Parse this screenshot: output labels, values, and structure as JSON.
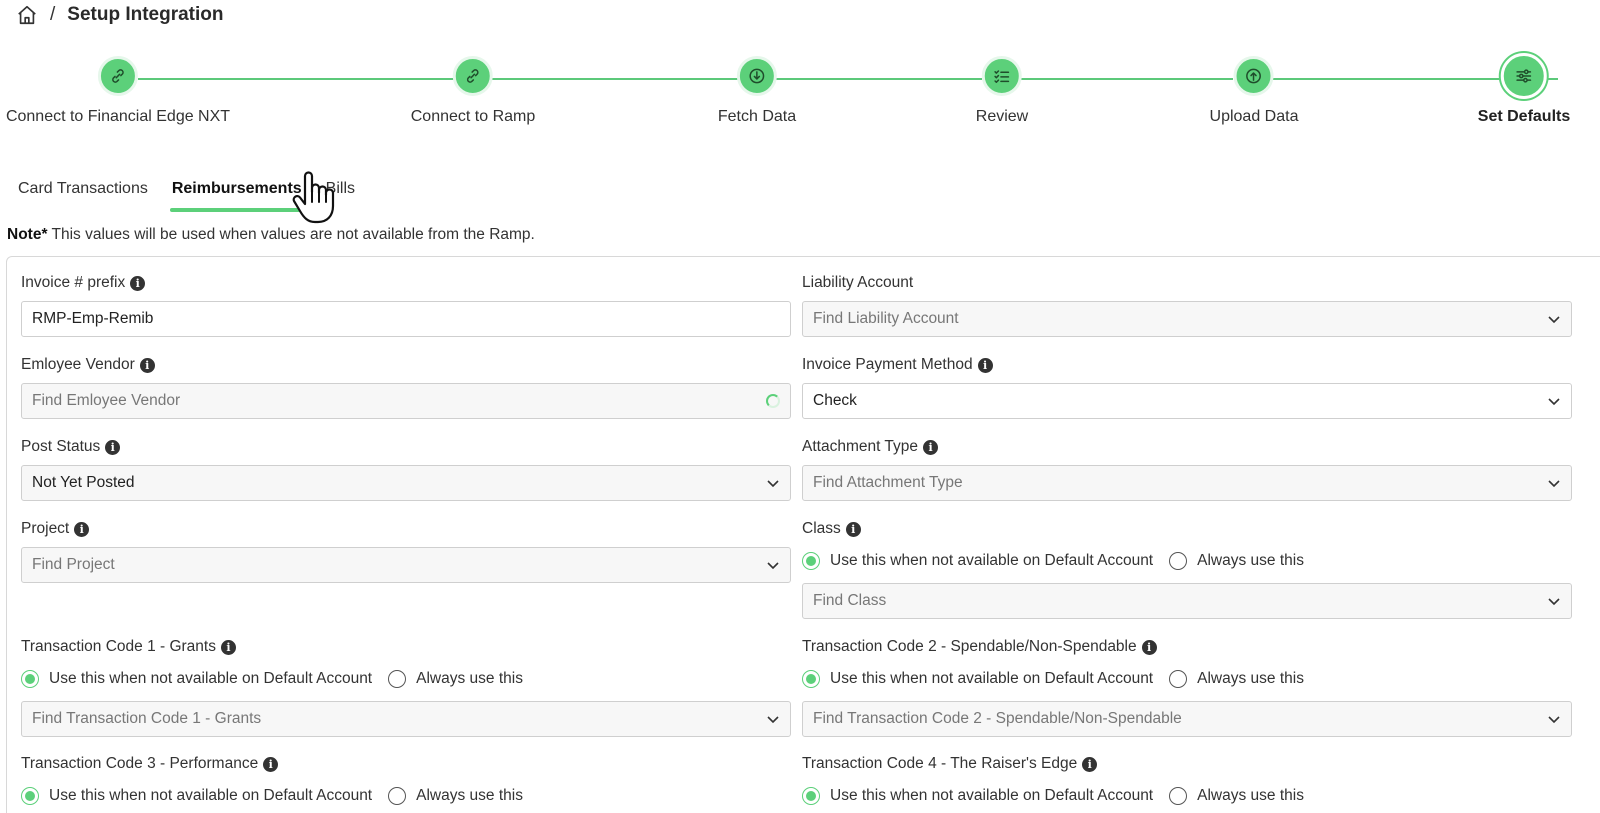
{
  "breadcrumb": {
    "separator": "/",
    "title": "Setup Integration"
  },
  "steps": [
    {
      "label": "Connect to Financial Edge NXT",
      "icon": "link-icon"
    },
    {
      "label": "Connect to Ramp",
      "icon": "link-icon"
    },
    {
      "label": "Fetch Data",
      "icon": "download-icon"
    },
    {
      "label": "Review",
      "icon": "checklist-icon"
    },
    {
      "label": "Upload Data",
      "icon": "upload-icon"
    },
    {
      "label": "Set Defaults",
      "icon": "sliders-icon",
      "current": true
    }
  ],
  "tabs": [
    {
      "label": "Card Transactions"
    },
    {
      "label": "Reimbursements",
      "active": true
    },
    {
      "label": "Bills"
    }
  ],
  "note": {
    "bold": "Note*",
    "text": " This values will be used when values are not available from the Ramp."
  },
  "fields": {
    "invoice_prefix": {
      "label": "Invoice # prefix",
      "value": "RMP-Emp-Remib"
    },
    "liability_account": {
      "label": "Liability Account",
      "placeholder": "Find Liability Account"
    },
    "employee_vendor": {
      "label": "Emloyee Vendor",
      "placeholder": "Find Emloyee Vendor"
    },
    "invoice_payment_method": {
      "label": "Invoice Payment Method",
      "value": "Check"
    },
    "post_status": {
      "label": "Post Status",
      "value": "Not Yet Posted"
    },
    "attachment_type": {
      "label": "Attachment Type",
      "placeholder": "Find Attachment Type"
    },
    "project": {
      "label": "Project",
      "placeholder": "Find Project"
    },
    "class": {
      "label": "Class",
      "placeholder": "Find Class"
    },
    "tc1": {
      "label": "Transaction Code 1 - Grants",
      "placeholder": "Find Transaction Code 1 - Grants"
    },
    "tc2": {
      "label": "Transaction Code 2 - Spendable/Non-Spendable",
      "placeholder": "Find Transaction Code 2 - Spendable/Non-Spendable"
    },
    "tc3": {
      "label": "Transaction Code 3 - Performance"
    },
    "tc4": {
      "label": "Transaction Code 4 - The Raiser's Edge"
    }
  },
  "radio": {
    "default_label": "Use this when not available on Default Account",
    "always_label": "Always use this"
  },
  "colors": {
    "accent": "#5cd07a",
    "line": "#5cc97a"
  }
}
